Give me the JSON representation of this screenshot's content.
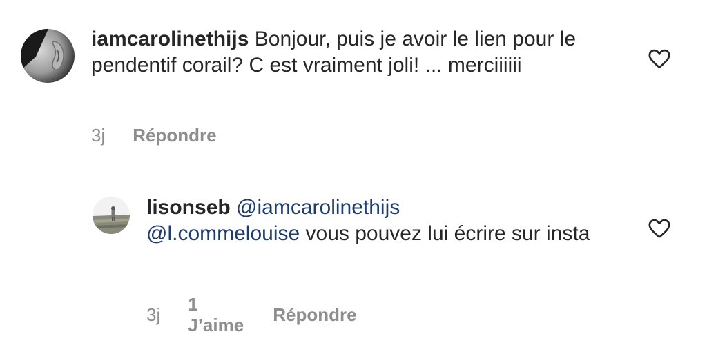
{
  "comments": [
    {
      "username": "iamcarolinethijs",
      "text": " Bonjour, puis je avoir le lien pour le pendentif corail? C est vraiment joli! ... merciiiiii",
      "time": "3j",
      "reply_label": "Répondre",
      "like_icon": "heart-outline-icon",
      "avatar_icon": "profile-photo-ear"
    },
    {
      "username": "lisonseb",
      "mention_1": "@iamcarolinethijs",
      "mention_2": "@l.commelouise",
      "text": " vous pouvez lui écrire sur insta",
      "time": "3j",
      "likes_label": "1 J’aime",
      "reply_label": "Répondre",
      "like_icon": "heart-outline-icon",
      "avatar_icon": "profile-photo-field"
    }
  ],
  "colors": {
    "text": "#262626",
    "secondary": "#8e8e8e",
    "mention": "#1e3d6b",
    "background": "#ffffff"
  }
}
